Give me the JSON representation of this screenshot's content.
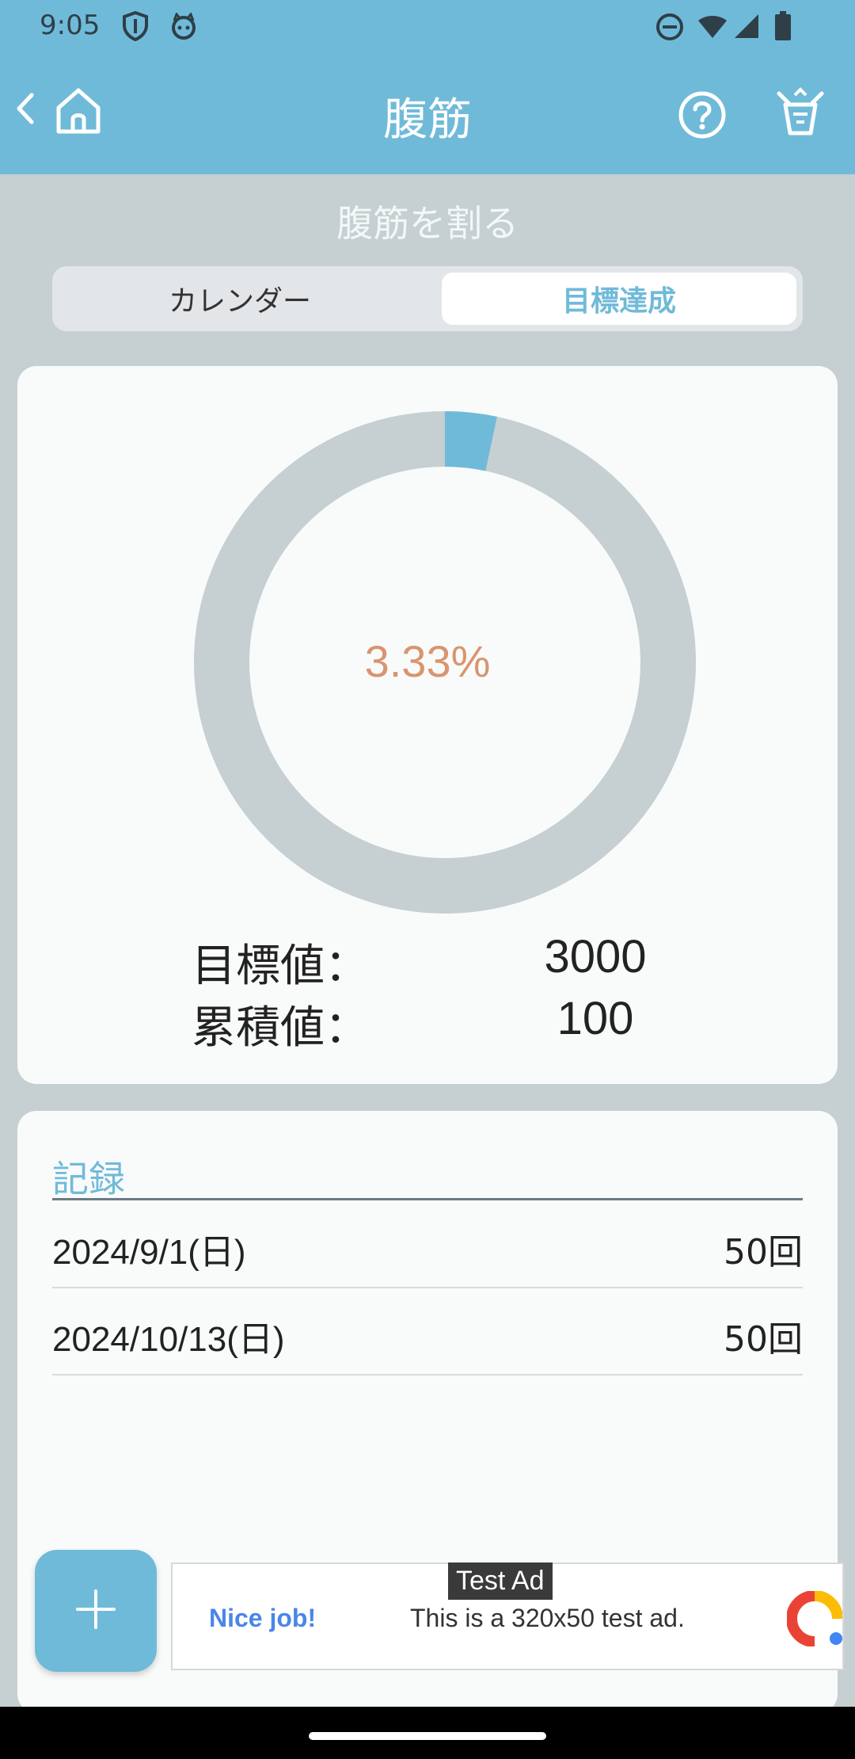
{
  "status_bar": {
    "time": "9:05",
    "icons": [
      "shield-icon",
      "cat-face-icon",
      "do-not-disturb-icon",
      "wifi-icon",
      "signal-icon",
      "battery-icon"
    ]
  },
  "app_bar": {
    "title": "腹筋",
    "icons": [
      "back-icon",
      "home-icon",
      "help-icon",
      "trophy-icon"
    ],
    "background_color": "#70bad9"
  },
  "page": {
    "subtitle": "腹筋を割る"
  },
  "tabs": [
    {
      "label": "カレンダー",
      "active": false
    },
    {
      "label": "目標達成",
      "active": true
    }
  ],
  "goal": {
    "percent_text": "3.33%",
    "progress_fraction": 0.0333,
    "target_label": "目標値：",
    "target_value": "3000",
    "cumulative_label": "累積値：",
    "cumulative_value": "100",
    "progress_color": "#70bad9",
    "track_color": "#c6cfd2",
    "percent_color": "#d9956f"
  },
  "records": {
    "heading": "記録",
    "items": [
      {
        "date": "2024/9/1(日)",
        "count": "50回"
      },
      {
        "date": "2024/10/13(日)",
        "count": "50回"
      }
    ]
  },
  "fab": {
    "icon": "plus-icon"
  },
  "ad": {
    "tag": "Test Ad",
    "headline": "Nice job!",
    "body": "This is a 320x50 test ad."
  }
}
